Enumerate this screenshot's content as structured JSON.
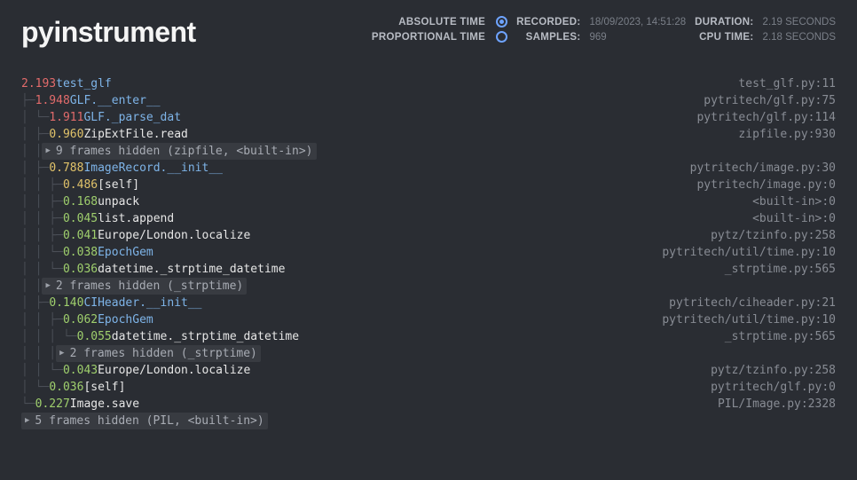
{
  "brand": "pyinstrument",
  "meta": {
    "abs_label": "ABSOLUTE TIME",
    "prop_label": "PROPORTIONAL TIME",
    "recorded_label": "RECORDED:",
    "recorded_value": "18/09/2023, 14:51:28",
    "samples_label": "SAMPLES:",
    "samples_value": "969",
    "duration_label": "DURATION:",
    "duration_value": "2.19 SECONDS",
    "cpu_label": "CPU TIME:",
    "cpu_value": "2.18 SECONDS"
  },
  "rows": [
    {
      "guides": "",
      "time": "2.193",
      "tc": "time-red",
      "name": "test_glf",
      "nc": "name-blue",
      "loc": "test_glf.py:11"
    },
    {
      "guides": "├─ ",
      "time": "1.948",
      "tc": "time-red",
      "name": "GLF.__enter__",
      "nc": "name-blue",
      "loc": "pytritech/glf.py:75"
    },
    {
      "guides": "│  └─ ",
      "time": "1.911",
      "tc": "time-red",
      "name": "GLF._parse_dat",
      "nc": "name-blue",
      "loc": "pytritech/glf.py:114"
    },
    {
      "guides": "│     ├─ ",
      "time": "0.960",
      "tc": "time-yellow",
      "name": "ZipExtFile.read",
      "nc": "name-white",
      "loc": "zipfile.py:930"
    },
    {
      "guides": "│     │     ",
      "hidden": "9 frames hidden (zipfile, <built-in>)"
    },
    {
      "guides": "│     ├─ ",
      "time": "0.788",
      "tc": "time-yellow",
      "name": "ImageRecord.__init__",
      "nc": "name-blue",
      "loc": "pytritech/image.py:30"
    },
    {
      "guides": "│     │  ├─ ",
      "time": "0.486",
      "tc": "time-yellow",
      "name": "[self]",
      "nc": "name-white",
      "loc": "pytritech/image.py:0"
    },
    {
      "guides": "│     │  ├─ ",
      "time": "0.168",
      "tc": "time-green",
      "name": "unpack",
      "nc": "name-white",
      "loc": "<built-in>:0"
    },
    {
      "guides": "│     │  ├─ ",
      "time": "0.045",
      "tc": "time-green",
      "name": "list.append",
      "nc": "name-white",
      "loc": "<built-in>:0"
    },
    {
      "guides": "│     │  ├─ ",
      "time": "0.041",
      "tc": "time-green",
      "name": "Europe/London.localize",
      "nc": "name-white",
      "loc": "pytz/tzinfo.py:258"
    },
    {
      "guides": "│     │  └─ ",
      "time": "0.038",
      "tc": "time-green",
      "name": "EpochGem",
      "nc": "name-blue",
      "loc": "pytritech/util/time.py:10"
    },
    {
      "guides": "│     │     └─ ",
      "time": "0.036",
      "tc": "time-green",
      "name": "datetime._strptime_datetime",
      "nc": "name-white",
      "loc": "_strptime.py:565"
    },
    {
      "guides": "│     │           ",
      "hidden": "2 frames hidden (_strptime)"
    },
    {
      "guides": "│     ├─ ",
      "time": "0.140",
      "tc": "time-green",
      "name": "CIHeader.__init__",
      "nc": "name-blue",
      "loc": "pytritech/ciheader.py:21"
    },
    {
      "guides": "│     │  ├─ ",
      "time": "0.062",
      "tc": "time-green",
      "name": "EpochGem",
      "nc": "name-blue",
      "loc": "pytritech/util/time.py:10"
    },
    {
      "guides": "│     │  │  └─ ",
      "time": "0.055",
      "tc": "time-green",
      "name": "datetime._strptime_datetime",
      "nc": "name-white",
      "loc": "_strptime.py:565"
    },
    {
      "guides": "│     │  │        ",
      "hidden": "2 frames hidden (_strptime)"
    },
    {
      "guides": "│     │  └─ ",
      "time": "0.043",
      "tc": "time-green",
      "name": "Europe/London.localize",
      "nc": "name-white",
      "loc": "pytz/tzinfo.py:258"
    },
    {
      "guides": "│     └─ ",
      "time": "0.036",
      "tc": "time-green",
      "name": "[self]",
      "nc": "name-white",
      "loc": "pytritech/glf.py:0"
    },
    {
      "guides": "└─ ",
      "time": "0.227",
      "tc": "time-green",
      "name": "Image.save",
      "nc": "name-white",
      "loc": "PIL/Image.py:2328"
    },
    {
      "guides": "      ",
      "hidden": "5 frames hidden (PIL, <built-in>)"
    }
  ]
}
